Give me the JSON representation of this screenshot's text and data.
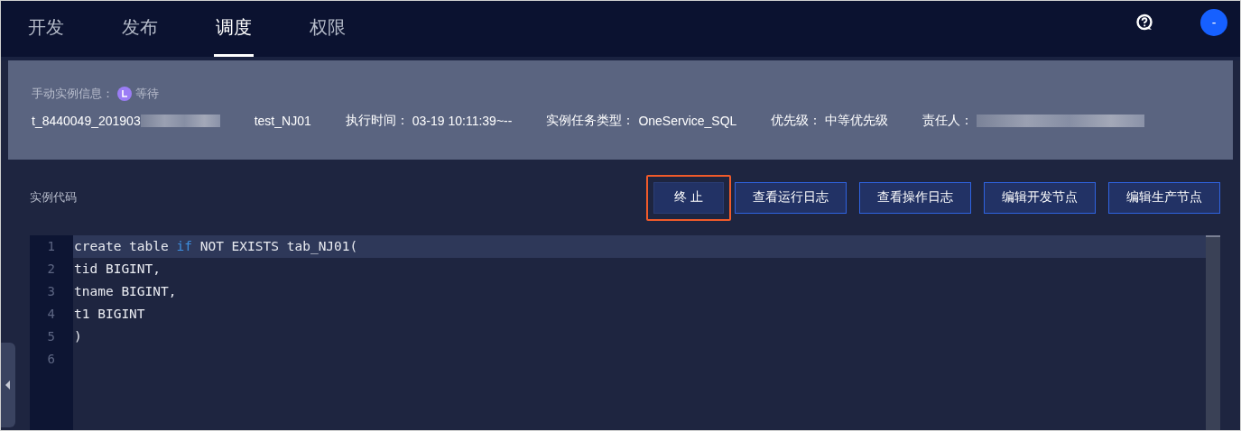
{
  "nav": {
    "tabs": [
      {
        "label": "开发",
        "selected": false
      },
      {
        "label": "发布",
        "selected": false
      },
      {
        "label": "调度",
        "selected": true
      },
      {
        "label": "权限",
        "selected": false
      }
    ],
    "avatar": "-"
  },
  "instance_info": {
    "title": "手动实例信息：",
    "status": "等待",
    "fields": [
      {
        "kind": "redacted",
        "value": "t_8440049_201903"
      },
      {
        "kind": "plain",
        "value": "test_NJ01"
      },
      {
        "kind": "labeled",
        "label": "执行时间：",
        "value": "03-19 10:11:39~--"
      },
      {
        "kind": "labeled",
        "label": "实例任务类型：",
        "value": "OneService_SQL"
      },
      {
        "kind": "labeled",
        "label": "优先级：",
        "value": "中等优先级"
      },
      {
        "kind": "labeled_redacted",
        "label": "责任人："
      }
    ]
  },
  "code_section": {
    "title": "实例代码",
    "buttons": [
      {
        "label": "终 止",
        "highlighted": true
      },
      {
        "label": "查看运行日志",
        "highlighted": false
      },
      {
        "label": "查看操作日志",
        "highlighted": false
      },
      {
        "label": "编辑开发节点",
        "highlighted": false
      },
      {
        "label": "编辑生产节点",
        "highlighted": false
      }
    ],
    "lines": [
      {
        "number": "1",
        "tokens": [
          {
            "kind": "plain",
            "text": "create table "
          },
          {
            "kind": "keyword",
            "text": "if"
          },
          {
            "kind": "plain",
            "text": " NOT EXISTS tab_NJ01("
          }
        ]
      },
      {
        "number": "2",
        "tokens": [
          {
            "kind": "plain",
            "text": "tid BIGINT,"
          }
        ]
      },
      {
        "number": "3",
        "tokens": [
          {
            "kind": "plain",
            "text": "tname BIGINT,"
          }
        ]
      },
      {
        "number": "4",
        "tokens": [
          {
            "kind": "plain",
            "text": "t1 BIGINT"
          }
        ]
      },
      {
        "number": "5",
        "tokens": [
          {
            "kind": "plain",
            "text": ")"
          }
        ]
      },
      {
        "number": "6"
      }
    ]
  }
}
